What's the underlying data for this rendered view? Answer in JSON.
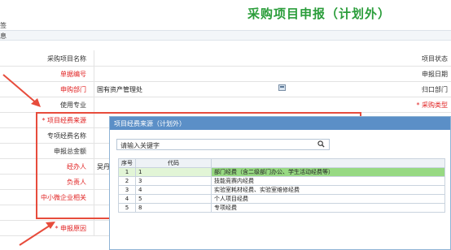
{
  "page": {
    "title": "采购项目申报（计划外）",
    "tab_label": "签",
    "toolbar_label": "息"
  },
  "form": {
    "rows": [
      {
        "label": "采购项目名称",
        "value": "",
        "right_label": "项目状态",
        "label_red": false,
        "right_red": false
      },
      {
        "label": "单据编号",
        "value": "",
        "right_label": "申报日期",
        "label_red": true,
        "right_red": false
      },
      {
        "label": "申购部门",
        "value": "国有资产管理处",
        "right_label": "归口部门",
        "label_red": true,
        "right_red": false
      },
      {
        "label": "使用专业",
        "value": "",
        "right_label": "* 采购类型",
        "label_red": false,
        "right_red": true
      },
      {
        "label": "* 项目经费来源",
        "value": "",
        "right_label": "",
        "label_red": true,
        "right_red": false
      },
      {
        "label": "专项经费名称",
        "value": "",
        "right_label": "",
        "label_red": false,
        "right_red": false
      },
      {
        "label": "申报总金额",
        "value": "",
        "right_label": "",
        "label_red": false,
        "right_red": false
      },
      {
        "label": "经办人",
        "value": "吴丹",
        "right_label": "",
        "label_red": true,
        "right_red": false
      },
      {
        "label": "负责人",
        "value": "",
        "right_label": "",
        "label_red": true,
        "right_red": false
      },
      {
        "label": "中小微企业相关",
        "value": "",
        "right_label": "",
        "label_red": true,
        "right_red": false
      },
      {
        "label": "",
        "value": "",
        "right_label": "",
        "label_red": false,
        "right_red": false
      },
      {
        "label": "* 申报原因",
        "value": "",
        "right_label": "",
        "label_red": true,
        "right_red": false
      }
    ]
  },
  "popup": {
    "title": "项目经费来源（计划外）",
    "search_placeholder": "请输入关键字",
    "columns": {
      "index": "序号",
      "code": "代码",
      "name": ""
    },
    "rows": [
      {
        "index": "1",
        "code": "1",
        "name": "部门经费（含二级部门办公、学生活动经费等）"
      },
      {
        "index": "2",
        "code": "3",
        "name": "技能竞赛内经费"
      },
      {
        "index": "3",
        "code": "4",
        "name": "实验室耗材经费、实验室维修经费"
      },
      {
        "index": "4",
        "code": "5",
        "name": "个人项目经费"
      },
      {
        "index": "5",
        "code": "8",
        "name": "专项经费"
      }
    ],
    "selected_index": 0
  },
  "colors": {
    "title_green": "#2a9d3a",
    "header_blue": "#5b8fc7",
    "highlight_red": "#e74c3c",
    "selected_green": "#97d982"
  }
}
